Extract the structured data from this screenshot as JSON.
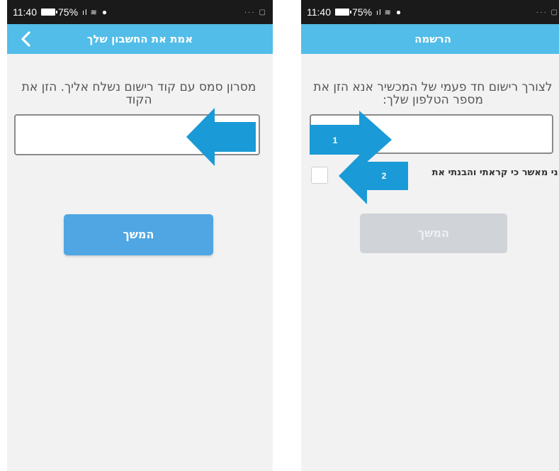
{
  "status_bar": {
    "time": "11:40",
    "battery": "75%",
    "signal": "▐ıl ≋ ⌸"
  },
  "screens": [
    {
      "header_title": "אמת את החשבון שלך",
      "instruction": "מסרון סמס עם קוד רישום נשלח אליך. הזן את הקוד",
      "code_input": {
        "value": "",
        "placeholder": ""
      },
      "continue_label": "המשך",
      "continue_enabled": true
    },
    {
      "header_title": "הרשמה",
      "instruction": "לצורך רישום חד פעמי של המכשיר אנא הזן את מספר הטלפון שלך:",
      "phone_input": {
        "value": "",
        "placeholder": ""
      },
      "terms_label": "אני מאשר כי קראתי והבנתי את",
      "terms_checked": false,
      "continue_label": "המשך",
      "continue_enabled": false
    }
  ],
  "annotations": {
    "arrow_1_label": "1",
    "arrow_2_label": "2",
    "arrow_color": "#1a9ad6"
  },
  "colors": {
    "header": "#52bde8",
    "button_active": "#4fa6e3",
    "button_disabled": "#d0d4d8"
  }
}
